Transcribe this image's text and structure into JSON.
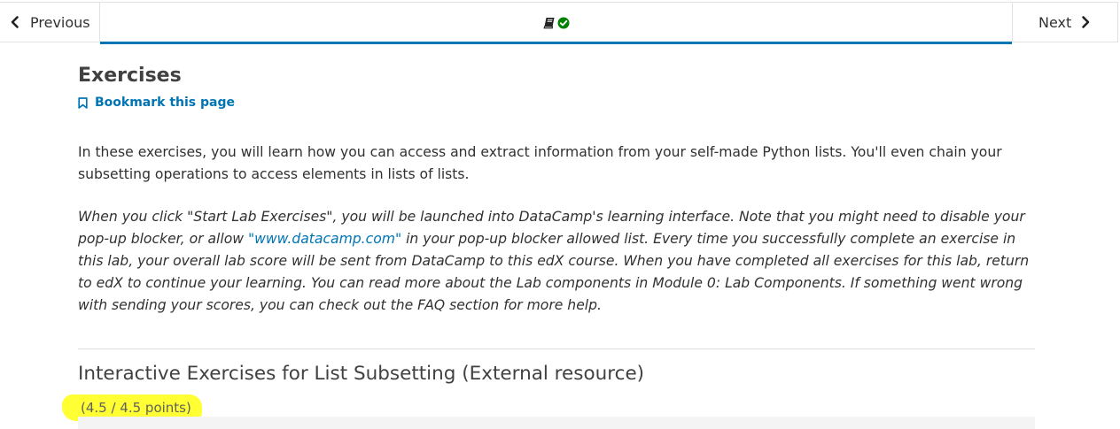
{
  "nav": {
    "previous_label": "Previous",
    "next_label": "Next",
    "tab_icons": [
      "book-icon",
      "check-circle-icon"
    ]
  },
  "page": {
    "title": "Exercises",
    "bookmark_label": "Bookmark this page",
    "intro": "In these exercises, you will learn how you can access and extract information from your self-made Python lists. You'll even chain your subsetting operations to access elements in lists of lists.",
    "note_part1": "When you click \"Start Lab Exercises\", you will be launched into DataCamp's learning interface. Note that you might need to disable your pop-up blocker, or allow ",
    "note_link": "\"www.datacamp.com\"",
    "note_part2": " in your pop-up blocker allowed list. Every time you successfully complete an exercise in this lab, your overall lab score will be sent from DataCamp to this edX course. When you have completed all exercises for this lab, return to edX to continue your learning. You can read more about the Lab components in Module 0: Lab Components. If something went wrong with sending your scores, you can check out the FAQ section for more help."
  },
  "problem": {
    "title": "Interactive Exercises for List Subsetting (External resource)",
    "score": "(4.5 / 4.5 points)"
  },
  "colors": {
    "accent": "#0075b4",
    "success": "#008100",
    "highlight": "#ffff33",
    "text": "#313131"
  }
}
